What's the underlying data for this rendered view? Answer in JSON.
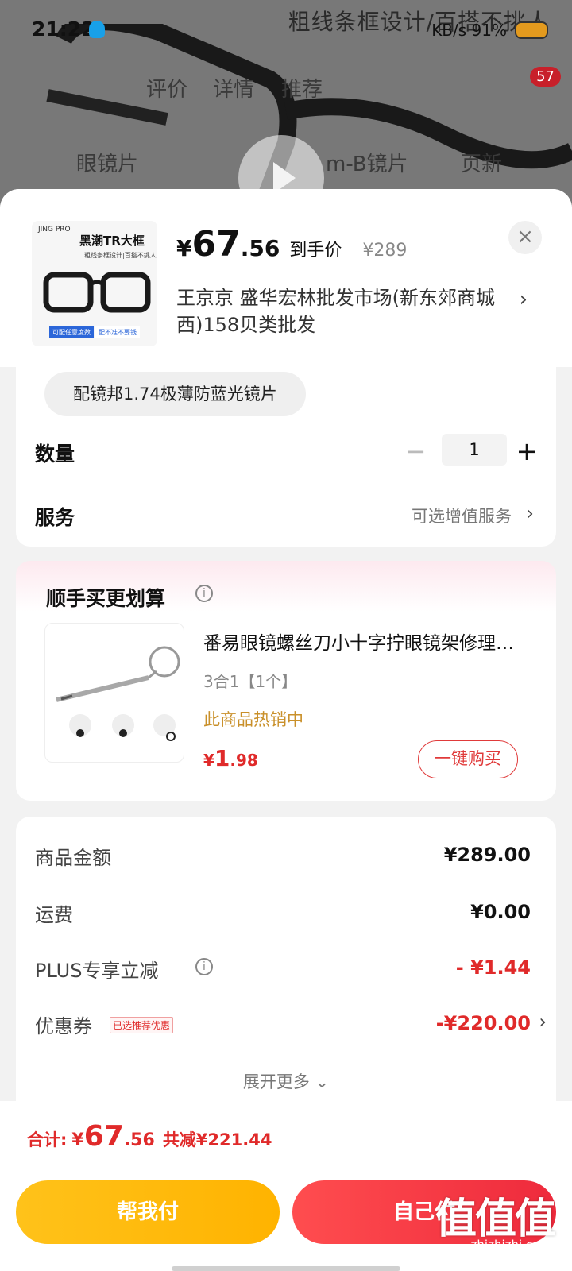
{
  "status_bar": {
    "time": "21:22",
    "right_text": "KB/s  91%"
  },
  "background": {
    "banner_text": "粗线条框设计/百搭不挑人",
    "tabs": [
      "评价",
      "详情",
      "推荐"
    ],
    "badge_count": "57",
    "row2": [
      "眼镜片",
      "m-B镜片",
      "页新"
    ]
  },
  "sheet": {
    "close_icon_text": "×",
    "thumbnail": {
      "logo": "JING PRO",
      "title": "黑潮TR大框",
      "subtitle": "粗线条框设计|百搭不挑人",
      "tag1": "可配任意度数",
      "tag2": "配不准不要钱"
    },
    "price": {
      "yen": "¥",
      "integer": "67",
      "decimal": ".56",
      "label": "到手价",
      "original": "¥289"
    },
    "shop": {
      "text": "王京京  盛华宏林批发市场(新东郊商城西)158贝类批发",
      "chevron": "›"
    },
    "spec_chip": "配镜邦1.74极薄防蓝光镜片",
    "quantity": {
      "label": "数量",
      "minus": "−",
      "value": "1",
      "plus": "+"
    },
    "service": {
      "label": "服务",
      "value": "可选增值服务",
      "chevron": "›"
    },
    "addon": {
      "title": "顺手买更划算",
      "info_icon": "i",
      "name": "番易眼镜螺丝刀小十字拧眼镜架修理工具迷你便携",
      "spec": "3合1【1个】",
      "hot": "此商品热销中",
      "price_yen": "¥",
      "price_int": "1",
      "price_dec": ".98",
      "buy_label": "一键购买"
    },
    "summary": {
      "rows": [
        {
          "label": "商品金额",
          "value": "¥289.00"
        },
        {
          "label": "运费",
          "value": "¥0.00"
        },
        {
          "label": "PLUS专享立减",
          "value": "- ¥1.44"
        },
        {
          "label": "优惠券",
          "tag": "已选推荐优惠",
          "value": "-¥220.00",
          "chevron": "›"
        }
      ],
      "expand_more": "展开更多 ⌄"
    },
    "total": {
      "label": "合计:",
      "yen": "¥",
      "integer": "67",
      "decimal": ".56",
      "saving": "共减¥221.44"
    },
    "actions": {
      "help_pay": "帮我付",
      "self_pay": "自己付"
    },
    "watermark": {
      "big": "值值值",
      "small": "zhizhizhi.com"
    }
  },
  "colors": {
    "accent_red": "#e02a2a",
    "help_yellow": "#ffbb10",
    "self_red": "#f03a46",
    "hot_gold": "#c9902a"
  }
}
